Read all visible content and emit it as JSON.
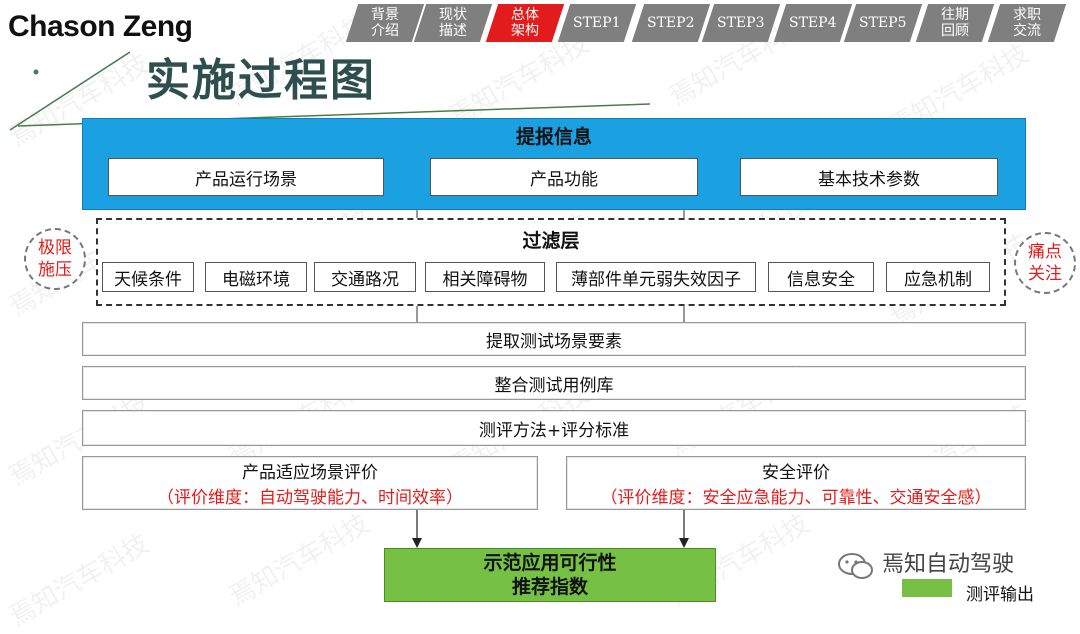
{
  "brand": "Chason Zeng",
  "page_title": "实施过程图",
  "nav_tabs": [
    {
      "label": "背景\n介绍",
      "active": false
    },
    {
      "label": "现状\n描述",
      "active": false
    },
    {
      "label": "总体\n架构",
      "active": true
    },
    {
      "label": "STEP1",
      "active": false
    },
    {
      "label": "STEP2",
      "active": false
    },
    {
      "label": "STEP3",
      "active": false
    },
    {
      "label": "STEP4",
      "active": false
    },
    {
      "label": "STEP5",
      "active": false
    },
    {
      "label": "往期\n回顾",
      "active": false
    },
    {
      "label": "求职\n交流",
      "active": false
    }
  ],
  "report": {
    "title": "提报信息",
    "items": [
      "产品运行场景",
      "产品功能",
      "基本技术参数"
    ]
  },
  "filter": {
    "title": "过滤层",
    "items": [
      "天候条件",
      "电磁环境",
      "交通路况",
      "相关障碍物",
      "薄部件单元弱失效因子",
      "信息安全",
      "应急机制"
    ]
  },
  "side_left": "极限\n施压",
  "side_right": "痛点\n关注",
  "steps": [
    "提取测试场景要素",
    "整合测试用例库",
    "测评方法+评分标准"
  ],
  "evaluations": [
    {
      "title": "产品适应场景评价",
      "note": "（评价维度：自动驾驶能力、时间效率）"
    },
    {
      "title": "安全评价",
      "note": "（评价维度：安全应急能力、可靠性、交通安全感）"
    }
  ],
  "output": "示范应用可行性\n推荐指数",
  "legend": {
    "label": "测评输出",
    "color": "#76c043"
  },
  "footer_text": "焉知自动驾驶",
  "watermark": "焉知汽车科技",
  "colors": {
    "accent_red": "#e21c1c",
    "report_blue": "#1ba1e2",
    "output_green": "#76c043",
    "tab_gray": "#7f7f7f"
  }
}
